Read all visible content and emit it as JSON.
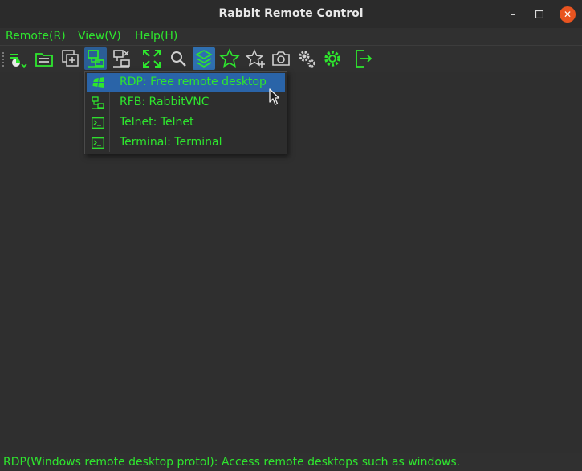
{
  "window": {
    "title": "Rabbit Remote Control"
  },
  "menubar": {
    "items": [
      "Remote(R)",
      "View(V)",
      "Help(H)"
    ]
  },
  "toolbar": {
    "buttons": [
      "start-icon",
      "open-list-icon",
      "add-to-list-icon",
      "connect-icon",
      "disconnect-icon",
      "fullscreen-icon",
      "zoom-icon",
      "layers-icon",
      "favorite-icon",
      "add-favorite-icon",
      "screenshot-icon",
      "settings-icon",
      "settings-green-icon",
      "exit-icon"
    ],
    "accent": "#2ee62e"
  },
  "dropdown": {
    "items": [
      {
        "label": "RDP: Free remote desktop",
        "icon": "windows-icon",
        "highlighted": true
      },
      {
        "label": "RFB: RabbitVNC",
        "icon": "network-icon",
        "highlighted": false
      },
      {
        "label": "Telnet: Telnet",
        "icon": "terminal-icon",
        "highlighted": false
      },
      {
        "label": "Terminal: Terminal",
        "icon": "terminal-icon",
        "highlighted": false
      }
    ]
  },
  "statusbar": {
    "text": "RDP(Windows remote desktop protol): Access remote desktops such as windows."
  }
}
